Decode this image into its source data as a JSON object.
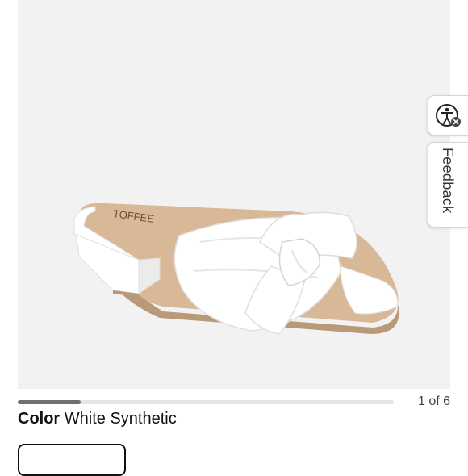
{
  "product": {
    "image_alt": "White Synthetic bow slide sandal",
    "brand_stamp": "TOFFEE",
    "colors": {
      "background": "#f2f2f2",
      "shoe": "#ffffff",
      "insole": "#d8b896",
      "sole": "#b89a78"
    }
  },
  "gallery": {
    "counter_text": "1 of 6",
    "current": 1,
    "total": 6,
    "progress_fraction": 0.167
  },
  "color_selector": {
    "label": "Color",
    "value": "White Synthetic"
  },
  "side_tabs": {
    "accessibility_icon": "accessibility-icon",
    "feedback_label": "Feedback"
  }
}
